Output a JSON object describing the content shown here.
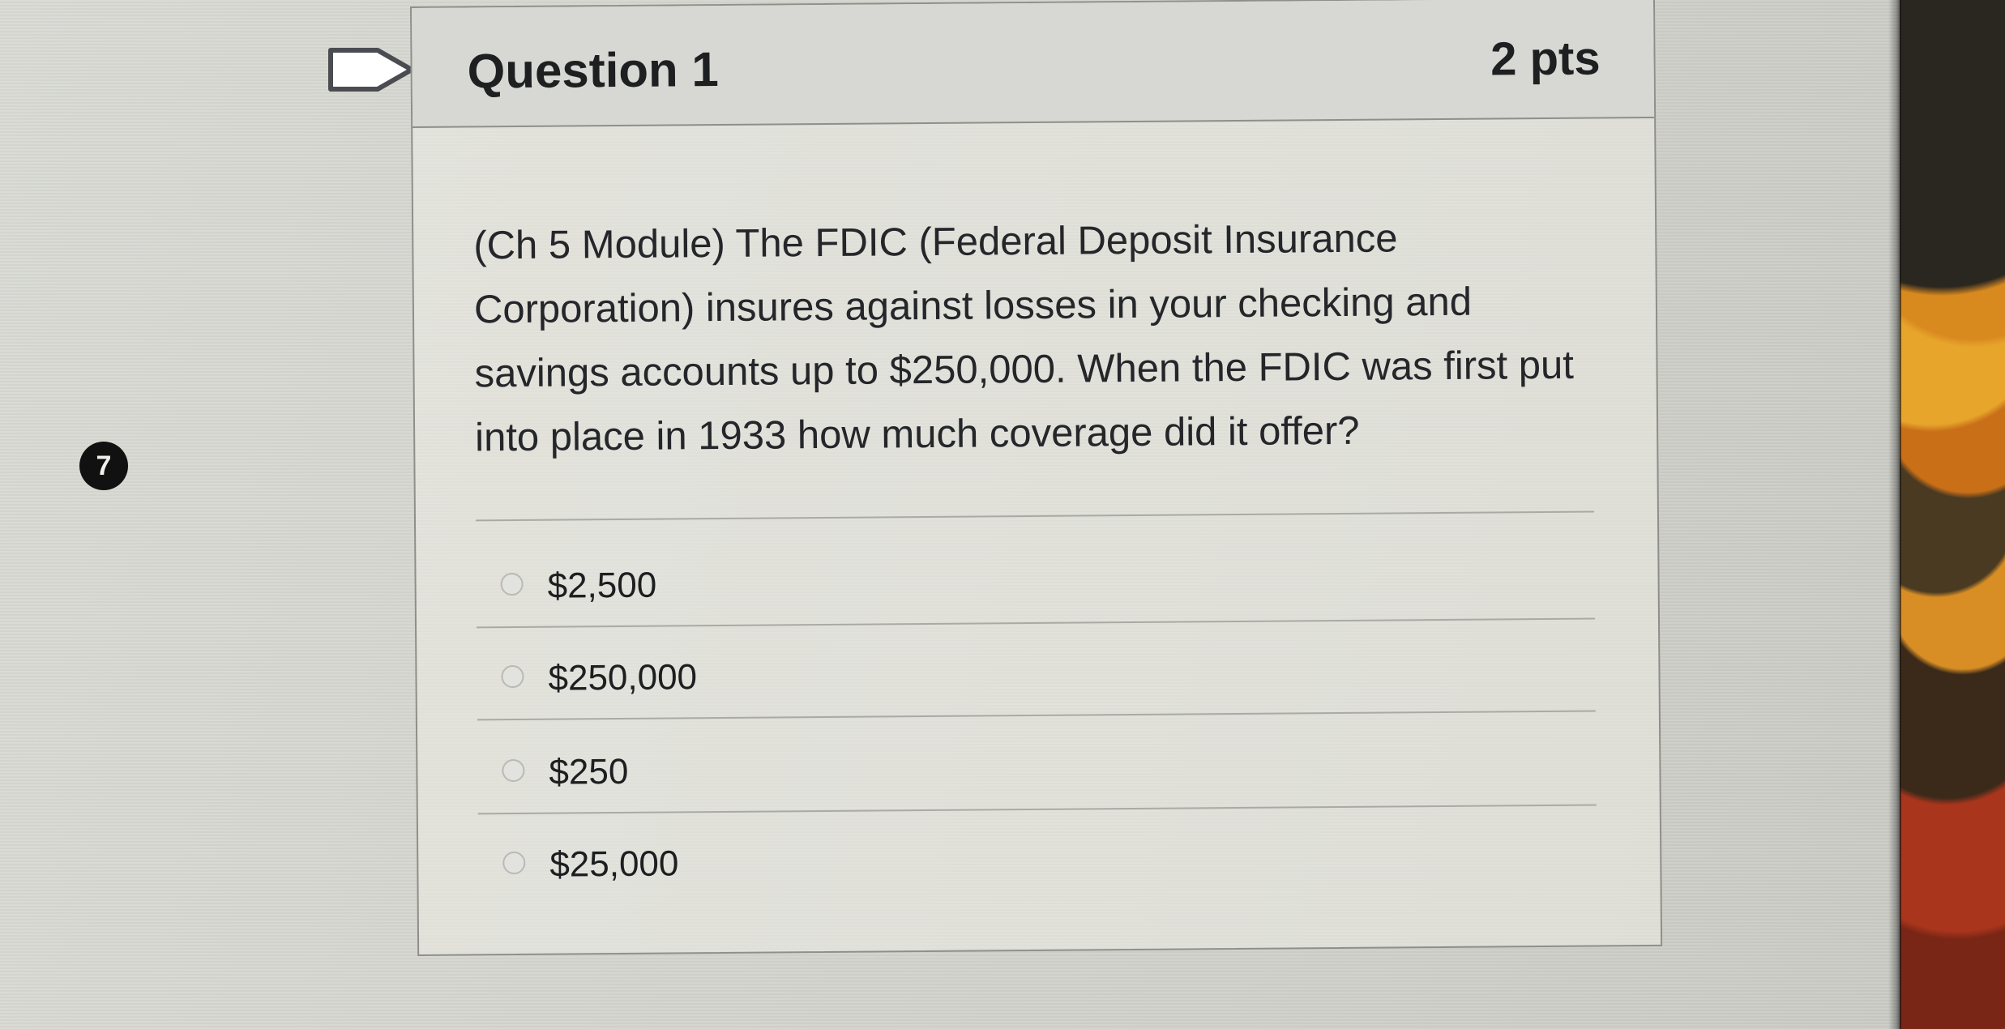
{
  "question": {
    "title": "Question 1",
    "points": "2 pts",
    "text": "(Ch 5 Module) The FDIC (Federal Deposit Insurance Corporation) insures against losses in your checking and savings accounts up to $250,000. When the FDIC was first put into place in 1933 how much coverage did it offer?",
    "options": [
      {
        "label": "$2,500"
      },
      {
        "label": "$250,000"
      },
      {
        "label": "$250"
      },
      {
        "label": "$25,000"
      }
    ]
  },
  "navigator": {
    "question_number": "7"
  },
  "icons": {
    "bookmark": "bookmark-flag-icon",
    "radio": "radio-button-icon"
  },
  "colors": {
    "header_bg": "#d7d8d3",
    "border": "#8e8f8a",
    "text": "#1e1f21"
  }
}
